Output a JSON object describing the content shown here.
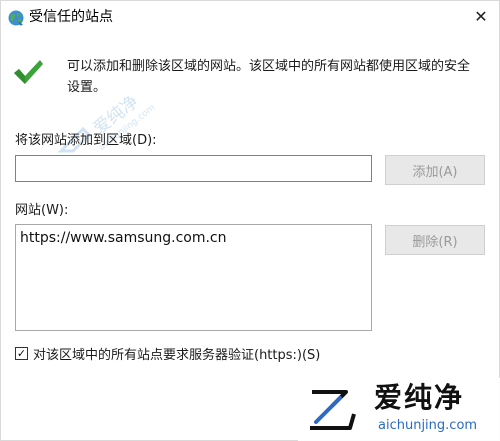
{
  "window": {
    "title": "受信任的站点",
    "close_glyph": "✕"
  },
  "description": "可以添加和删除该区域的网站。该区域中的所有网站都使用区域的安全设置。",
  "add_label": "将该网站添加到区域(D):",
  "add_input": {
    "value": "",
    "placeholder": ""
  },
  "add_button": "添加(A)",
  "sites_label": "网站(W):",
  "sites": [
    "https://www.samsung.com.cn"
  ],
  "remove_button": "删除(R)",
  "require_https": {
    "checked": true,
    "label": "对该区域中的所有站点要求服务器验证(https:)(S)"
  },
  "watermark": {
    "name_cn": "爱纯净",
    "domain": "aichunjing.com"
  },
  "colors": {
    "check_green": "#3aa33a",
    "input_focus_border": "#4a90c8",
    "disabled_button_text": "#9a9a9a",
    "watermark_blue": "#2b6bc4"
  },
  "icons": {
    "title": "trusted-sites-globe-icon",
    "status": "green-checkmark-icon",
    "close": "close-icon",
    "watermark_logo": "aichunjing-logo-icon"
  }
}
